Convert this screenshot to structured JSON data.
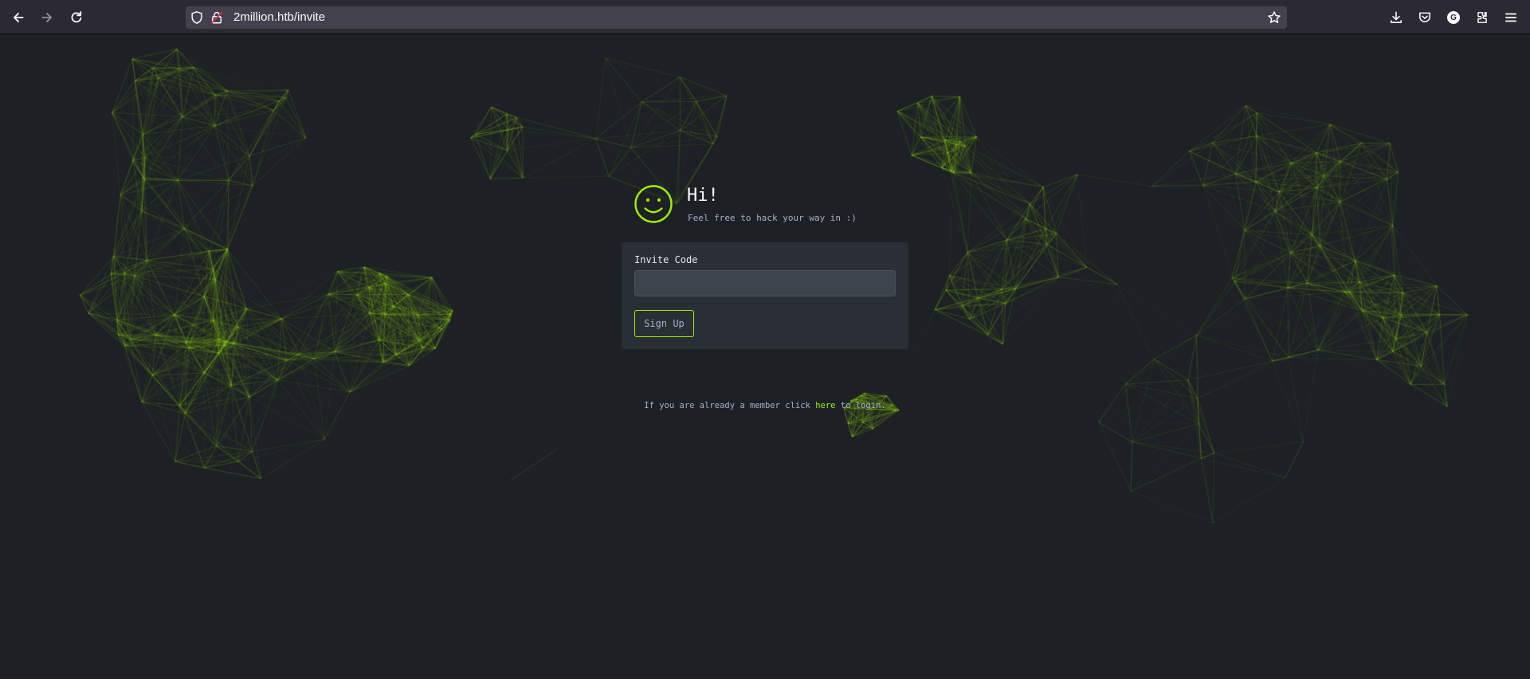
{
  "browser": {
    "url_host": "2million.htb",
    "url_path": "/invite",
    "account_initial": "G",
    "icons": [
      "back-icon",
      "forward-icon",
      "reload-icon",
      "shield-icon",
      "insecure-lock-icon",
      "bookmark-star-icon",
      "downloads-icon",
      "pocket-icon",
      "extensions-icon",
      "menu-icon"
    ]
  },
  "page": {
    "greeting": "Hi!",
    "tagline": "Feel free to hack your way in :)",
    "form": {
      "label": "Invite Code",
      "input_value": "",
      "button_label": "Sign Up"
    },
    "login": {
      "prefix": "If you are already a member click",
      "link": "here",
      "suffix": "to login."
    }
  },
  "colors": {
    "background": "#1d2025",
    "panel": "#2a2e35",
    "accent": "#9fef00",
    "text_muted": "#a4b1cd"
  }
}
